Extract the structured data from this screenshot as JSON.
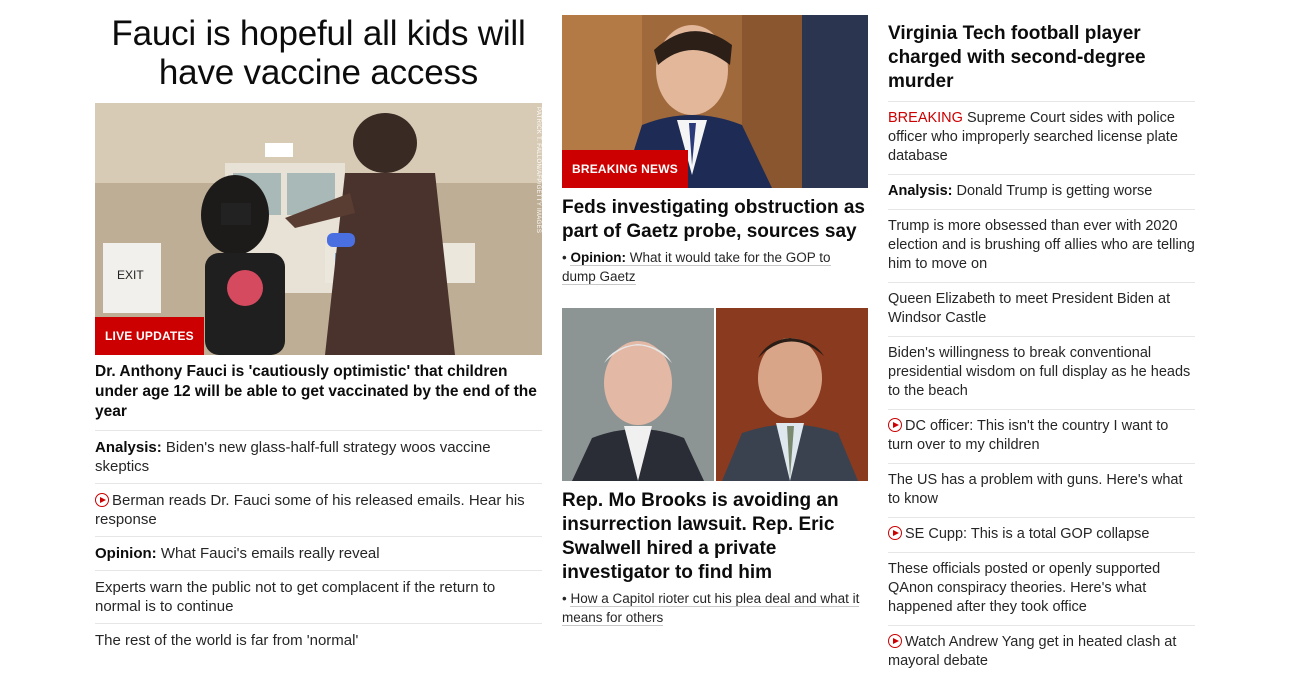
{
  "left": {
    "hero_title": "Fauci is hopeful all kids will have vaccine access",
    "badge": "LIVE UPDATES",
    "photo_credit": "PATRICK T. FALLON/AFP/GETTY IMAGES",
    "lead_headline": "Dr. Anthony Fauci is 'cautiously optimistic' that children under age 12 will be able to get vaccinated by the end of the year",
    "stories": [
      {
        "label": "Analysis:",
        "text": " Biden's new glass-half-full strategy woos vaccine skeptics"
      },
      {
        "video": true,
        "text": "Berman reads Dr. Fauci some of his released emails. Hear his response"
      },
      {
        "label": "Opinion:",
        "text": " What Fauci's emails really reveal"
      },
      {
        "text": "Experts warn the public not to get complacent if the return to normal is to continue"
      },
      {
        "text": "The rest of the world is far from 'normal'"
      }
    ]
  },
  "middle": {
    "top": {
      "badge": "BREAKING NEWS",
      "headline": "Feds investigating obstruction as part of Gaetz probe, sources say",
      "sub_label": "Opinion:",
      "sub_text": " What it would take for the GOP to dump Gaetz"
    },
    "bottom": {
      "headline": "Rep. Mo Brooks is avoiding an insurrection lawsuit. Rep. Eric Swalwell hired a private investigator to find him",
      "sub_text": "How a Capitol rioter cut his plea deal and what it means for others"
    }
  },
  "right": {
    "headline": "Virginia Tech football player charged with second-degree murder",
    "stories": [
      {
        "tag": "BREAKING",
        "text": " Supreme Court sides with police officer who improperly searched license plate database"
      },
      {
        "label": "Analysis:",
        "text": " Donald Trump is getting worse"
      },
      {
        "text": "Trump is more obsessed than ever with 2020 election and is brushing off allies who are telling him to move on"
      },
      {
        "text": "Queen Elizabeth to meet President Biden at Windsor Castle"
      },
      {
        "text": "Biden's willingness to break conventional presidential wisdom on full display as he heads to the beach"
      },
      {
        "video": true,
        "text": "DC officer: This isn't the country I want to turn over to my children"
      },
      {
        "text": "The US has a problem with guns. Here's what to know"
      },
      {
        "video": true,
        "text": "SE Cupp: This is a total GOP collapse"
      },
      {
        "text": "These officials posted or openly supported QAnon conspiracy theories. Here's what happened after they took office"
      },
      {
        "video": true,
        "text": "Watch Andrew Yang get in heated clash at mayoral debate"
      }
    ]
  },
  "colors": {
    "accent_red": "#cc0000",
    "text": "#262626",
    "divider": "#e6e6e6"
  }
}
